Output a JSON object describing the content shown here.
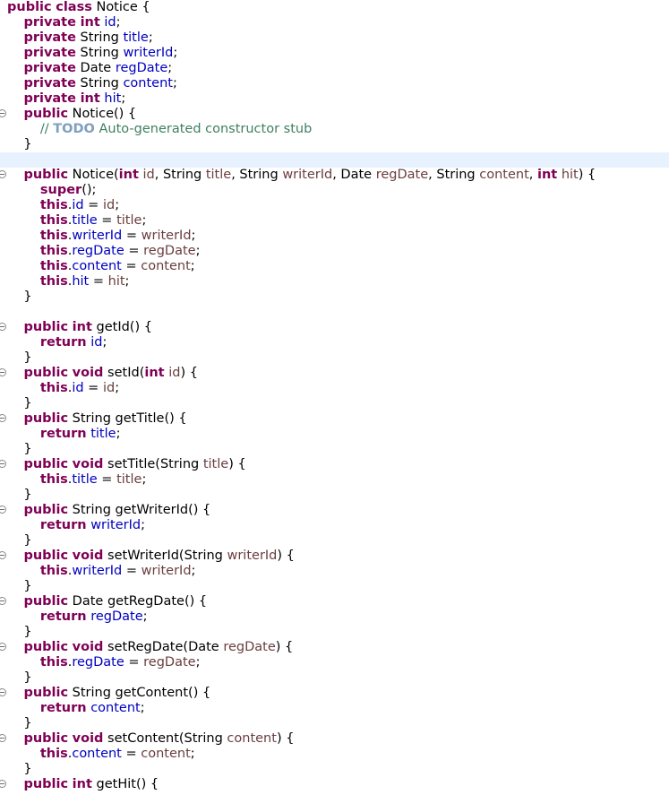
{
  "editor": {
    "language": "java",
    "current_line_index": 10,
    "colors": {
      "keyword": "#7f0055",
      "field": "#0000c0",
      "parameter": "#6a3e3e",
      "comment": "#3f7f5f",
      "todo_tag": "#7f9fbf",
      "current_line_background": "#e8f2fe"
    },
    "lines": [
      {
        "fold": false,
        "tokens": [
          [
            "k",
            "public"
          ],
          [
            "p",
            " "
          ],
          [
            "k",
            "class"
          ],
          [
            "p",
            " Notice {"
          ]
        ]
      },
      {
        "fold": false,
        "tokens": [
          [
            "p",
            "    "
          ],
          [
            "k",
            "private"
          ],
          [
            "p",
            " "
          ],
          [
            "k",
            "int"
          ],
          [
            "p",
            " "
          ],
          [
            "f",
            "id"
          ],
          [
            "p",
            ";"
          ]
        ]
      },
      {
        "fold": false,
        "tokens": [
          [
            "p",
            "    "
          ],
          [
            "k",
            "private"
          ],
          [
            "p",
            " String "
          ],
          [
            "f",
            "title"
          ],
          [
            "p",
            ";"
          ]
        ]
      },
      {
        "fold": false,
        "tokens": [
          [
            "p",
            "    "
          ],
          [
            "k",
            "private"
          ],
          [
            "p",
            " String "
          ],
          [
            "f",
            "writerId"
          ],
          [
            "p",
            ";"
          ]
        ]
      },
      {
        "fold": false,
        "tokens": [
          [
            "p",
            "    "
          ],
          [
            "k",
            "private"
          ],
          [
            "p",
            " Date "
          ],
          [
            "f",
            "regDate"
          ],
          [
            "p",
            ";"
          ]
        ]
      },
      {
        "fold": false,
        "tokens": [
          [
            "p",
            "    "
          ],
          [
            "k",
            "private"
          ],
          [
            "p",
            " String "
          ],
          [
            "f",
            "content"
          ],
          [
            "p",
            ";"
          ]
        ]
      },
      {
        "fold": false,
        "tokens": [
          [
            "p",
            "    "
          ],
          [
            "k",
            "private"
          ],
          [
            "p",
            " "
          ],
          [
            "k",
            "int"
          ],
          [
            "p",
            " "
          ],
          [
            "f",
            "hit"
          ],
          [
            "p",
            ";"
          ]
        ]
      },
      {
        "fold": true,
        "tokens": [
          [
            "p",
            "    "
          ],
          [
            "k",
            "public"
          ],
          [
            "p",
            " Notice() {"
          ]
        ]
      },
      {
        "fold": false,
        "tokens": [
          [
            "p",
            "        "
          ],
          [
            "c",
            "// "
          ],
          [
            "t",
            "TODO"
          ],
          [
            "c",
            " Auto-generated constructor stub"
          ]
        ]
      },
      {
        "fold": false,
        "tokens": [
          [
            "p",
            "    }"
          ]
        ]
      },
      {
        "fold": false,
        "tokens": [
          [
            "p",
            " "
          ]
        ]
      },
      {
        "fold": true,
        "tokens": [
          [
            "p",
            "    "
          ],
          [
            "k",
            "public"
          ],
          [
            "p",
            " Notice("
          ],
          [
            "k",
            "int"
          ],
          [
            "p",
            " "
          ],
          [
            "a",
            "id"
          ],
          [
            "p",
            ", String "
          ],
          [
            "a",
            "title"
          ],
          [
            "p",
            ", String "
          ],
          [
            "a",
            "writerId"
          ],
          [
            "p",
            ", Date "
          ],
          [
            "a",
            "regDate"
          ],
          [
            "p",
            ", String "
          ],
          [
            "a",
            "content"
          ],
          [
            "p",
            ", "
          ],
          [
            "k",
            "int"
          ],
          [
            "p",
            " "
          ],
          [
            "a",
            "hit"
          ],
          [
            "p",
            ") {"
          ]
        ]
      },
      {
        "fold": false,
        "tokens": [
          [
            "p",
            "        "
          ],
          [
            "k",
            "super"
          ],
          [
            "p",
            "();"
          ]
        ]
      },
      {
        "fold": false,
        "tokens": [
          [
            "p",
            "        "
          ],
          [
            "k",
            "this"
          ],
          [
            "p",
            "."
          ],
          [
            "f",
            "id"
          ],
          [
            "p",
            " = "
          ],
          [
            "a",
            "id"
          ],
          [
            "p",
            ";"
          ]
        ]
      },
      {
        "fold": false,
        "tokens": [
          [
            "p",
            "        "
          ],
          [
            "k",
            "this"
          ],
          [
            "p",
            "."
          ],
          [
            "f",
            "title"
          ],
          [
            "p",
            " = "
          ],
          [
            "a",
            "title"
          ],
          [
            "p",
            ";"
          ]
        ]
      },
      {
        "fold": false,
        "tokens": [
          [
            "p",
            "        "
          ],
          [
            "k",
            "this"
          ],
          [
            "p",
            "."
          ],
          [
            "f",
            "writerId"
          ],
          [
            "p",
            " = "
          ],
          [
            "a",
            "writerId"
          ],
          [
            "p",
            ";"
          ]
        ]
      },
      {
        "fold": false,
        "tokens": [
          [
            "p",
            "        "
          ],
          [
            "k",
            "this"
          ],
          [
            "p",
            "."
          ],
          [
            "f",
            "regDate"
          ],
          [
            "p",
            " = "
          ],
          [
            "a",
            "regDate"
          ],
          [
            "p",
            ";"
          ]
        ]
      },
      {
        "fold": false,
        "tokens": [
          [
            "p",
            "        "
          ],
          [
            "k",
            "this"
          ],
          [
            "p",
            "."
          ],
          [
            "f",
            "content"
          ],
          [
            "p",
            " = "
          ],
          [
            "a",
            "content"
          ],
          [
            "p",
            ";"
          ]
        ]
      },
      {
        "fold": false,
        "tokens": [
          [
            "p",
            "        "
          ],
          [
            "k",
            "this"
          ],
          [
            "p",
            "."
          ],
          [
            "f",
            "hit"
          ],
          [
            "p",
            " = "
          ],
          [
            "a",
            "hit"
          ],
          [
            "p",
            ";"
          ]
        ]
      },
      {
        "fold": false,
        "tokens": [
          [
            "p",
            "    }"
          ]
        ]
      },
      {
        "fold": false,
        "tokens": [
          [
            "p",
            " "
          ]
        ]
      },
      {
        "fold": true,
        "tokens": [
          [
            "p",
            "    "
          ],
          [
            "k",
            "public"
          ],
          [
            "p",
            " "
          ],
          [
            "k",
            "int"
          ],
          [
            "p",
            " getId() {"
          ]
        ]
      },
      {
        "fold": false,
        "tokens": [
          [
            "p",
            "        "
          ],
          [
            "k",
            "return"
          ],
          [
            "p",
            " "
          ],
          [
            "f",
            "id"
          ],
          [
            "p",
            ";"
          ]
        ]
      },
      {
        "fold": false,
        "tokens": [
          [
            "p",
            "    }"
          ]
        ]
      },
      {
        "fold": true,
        "tokens": [
          [
            "p",
            "    "
          ],
          [
            "k",
            "public"
          ],
          [
            "p",
            " "
          ],
          [
            "k",
            "void"
          ],
          [
            "p",
            " setId("
          ],
          [
            "k",
            "int"
          ],
          [
            "p",
            " "
          ],
          [
            "a",
            "id"
          ],
          [
            "p",
            ") {"
          ]
        ]
      },
      {
        "fold": false,
        "tokens": [
          [
            "p",
            "        "
          ],
          [
            "k",
            "this"
          ],
          [
            "p",
            "."
          ],
          [
            "f",
            "id"
          ],
          [
            "p",
            " = "
          ],
          [
            "a",
            "id"
          ],
          [
            "p",
            ";"
          ]
        ]
      },
      {
        "fold": false,
        "tokens": [
          [
            "p",
            "    }"
          ]
        ]
      },
      {
        "fold": true,
        "tokens": [
          [
            "p",
            "    "
          ],
          [
            "k",
            "public"
          ],
          [
            "p",
            " String getTitle() {"
          ]
        ]
      },
      {
        "fold": false,
        "tokens": [
          [
            "p",
            "        "
          ],
          [
            "k",
            "return"
          ],
          [
            "p",
            " "
          ],
          [
            "f",
            "title"
          ],
          [
            "p",
            ";"
          ]
        ]
      },
      {
        "fold": false,
        "tokens": [
          [
            "p",
            "    }"
          ]
        ]
      },
      {
        "fold": true,
        "tokens": [
          [
            "p",
            "    "
          ],
          [
            "k",
            "public"
          ],
          [
            "p",
            " "
          ],
          [
            "k",
            "void"
          ],
          [
            "p",
            " setTitle(String "
          ],
          [
            "a",
            "title"
          ],
          [
            "p",
            ") {"
          ]
        ]
      },
      {
        "fold": false,
        "tokens": [
          [
            "p",
            "        "
          ],
          [
            "k",
            "this"
          ],
          [
            "p",
            "."
          ],
          [
            "f",
            "title"
          ],
          [
            "p",
            " = "
          ],
          [
            "a",
            "title"
          ],
          [
            "p",
            ";"
          ]
        ]
      },
      {
        "fold": false,
        "tokens": [
          [
            "p",
            "    }"
          ]
        ]
      },
      {
        "fold": true,
        "tokens": [
          [
            "p",
            "    "
          ],
          [
            "k",
            "public"
          ],
          [
            "p",
            " String getWriterId() {"
          ]
        ]
      },
      {
        "fold": false,
        "tokens": [
          [
            "p",
            "        "
          ],
          [
            "k",
            "return"
          ],
          [
            "p",
            " "
          ],
          [
            "f",
            "writerId"
          ],
          [
            "p",
            ";"
          ]
        ]
      },
      {
        "fold": false,
        "tokens": [
          [
            "p",
            "    }"
          ]
        ]
      },
      {
        "fold": true,
        "tokens": [
          [
            "p",
            "    "
          ],
          [
            "k",
            "public"
          ],
          [
            "p",
            " "
          ],
          [
            "k",
            "void"
          ],
          [
            "p",
            " setWriterId(String "
          ],
          [
            "a",
            "writerId"
          ],
          [
            "p",
            ") {"
          ]
        ]
      },
      {
        "fold": false,
        "tokens": [
          [
            "p",
            "        "
          ],
          [
            "k",
            "this"
          ],
          [
            "p",
            "."
          ],
          [
            "f",
            "writerId"
          ],
          [
            "p",
            " = "
          ],
          [
            "a",
            "writerId"
          ],
          [
            "p",
            ";"
          ]
        ]
      },
      {
        "fold": false,
        "tokens": [
          [
            "p",
            "    }"
          ]
        ]
      },
      {
        "fold": true,
        "tokens": [
          [
            "p",
            "    "
          ],
          [
            "k",
            "public"
          ],
          [
            "p",
            " Date getRegDate() {"
          ]
        ]
      },
      {
        "fold": false,
        "tokens": [
          [
            "p",
            "        "
          ],
          [
            "k",
            "return"
          ],
          [
            "p",
            " "
          ],
          [
            "f",
            "regDate"
          ],
          [
            "p",
            ";"
          ]
        ]
      },
      {
        "fold": false,
        "tokens": [
          [
            "p",
            "    }"
          ]
        ]
      },
      {
        "fold": true,
        "tokens": [
          [
            "p",
            "    "
          ],
          [
            "k",
            "public"
          ],
          [
            "p",
            " "
          ],
          [
            "k",
            "void"
          ],
          [
            "p",
            " setRegDate(Date "
          ],
          [
            "a",
            "regDate"
          ],
          [
            "p",
            ") {"
          ]
        ]
      },
      {
        "fold": false,
        "tokens": [
          [
            "p",
            "        "
          ],
          [
            "k",
            "this"
          ],
          [
            "p",
            "."
          ],
          [
            "f",
            "regDate"
          ],
          [
            "p",
            " = "
          ],
          [
            "a",
            "regDate"
          ],
          [
            "p",
            ";"
          ]
        ]
      },
      {
        "fold": false,
        "tokens": [
          [
            "p",
            "    }"
          ]
        ]
      },
      {
        "fold": true,
        "tokens": [
          [
            "p",
            "    "
          ],
          [
            "k",
            "public"
          ],
          [
            "p",
            " String getContent() {"
          ]
        ]
      },
      {
        "fold": false,
        "tokens": [
          [
            "p",
            "        "
          ],
          [
            "k",
            "return"
          ],
          [
            "p",
            " "
          ],
          [
            "f",
            "content"
          ],
          [
            "p",
            ";"
          ]
        ]
      },
      {
        "fold": false,
        "tokens": [
          [
            "p",
            "    }"
          ]
        ]
      },
      {
        "fold": true,
        "tokens": [
          [
            "p",
            "    "
          ],
          [
            "k",
            "public"
          ],
          [
            "p",
            " "
          ],
          [
            "k",
            "void"
          ],
          [
            "p",
            " setContent(String "
          ],
          [
            "a",
            "content"
          ],
          [
            "p",
            ") {"
          ]
        ]
      },
      {
        "fold": false,
        "tokens": [
          [
            "p",
            "        "
          ],
          [
            "k",
            "this"
          ],
          [
            "p",
            "."
          ],
          [
            "f",
            "content"
          ],
          [
            "p",
            " = "
          ],
          [
            "a",
            "content"
          ],
          [
            "p",
            ";"
          ]
        ]
      },
      {
        "fold": false,
        "tokens": [
          [
            "p",
            "    }"
          ]
        ]
      },
      {
        "fold": true,
        "tokens": [
          [
            "p",
            "    "
          ],
          [
            "k",
            "public"
          ],
          [
            "p",
            " "
          ],
          [
            "k",
            "int"
          ],
          [
            "p",
            " getHit() {"
          ]
        ]
      }
    ]
  }
}
